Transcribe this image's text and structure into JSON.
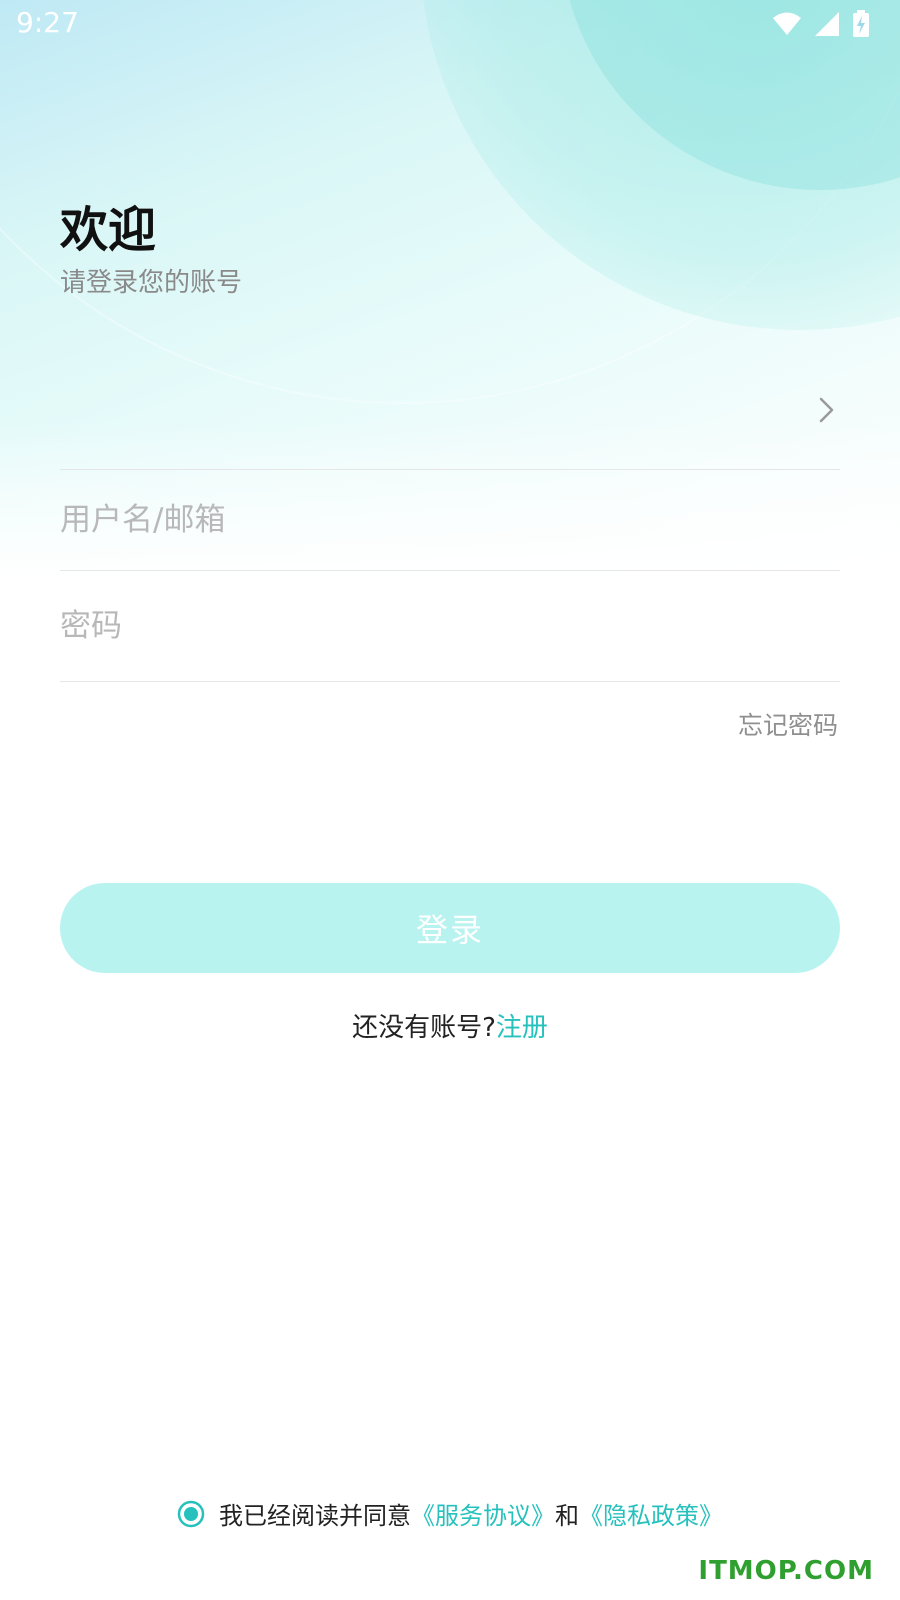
{
  "status_bar": {
    "time": "9:27",
    "icons": [
      "wifi-icon",
      "signal-icon",
      "battery-charging-icon"
    ]
  },
  "header": {
    "title": "欢迎",
    "subtitle": "请登录您的账号"
  },
  "server_selector": {
    "icon": "chevron-right-icon"
  },
  "form": {
    "username_placeholder": "用户名/邮箱",
    "username_value": "",
    "password_placeholder": "密码",
    "password_value": "",
    "forgot_label": "忘记密码",
    "login_label": "登录"
  },
  "register": {
    "prompt": "还没有账号?",
    "link": "注册"
  },
  "agreement": {
    "checked": true,
    "prefix": "我已经阅读并同意",
    "service_link": "《服务协议》",
    "conjunction": "和",
    "privacy_link": "《隐私政策》"
  },
  "watermark": "ITMOP.COM",
  "colors": {
    "accent": "#27c1bd",
    "button_bg": "#b8f3f0",
    "title": "#111111",
    "muted": "#8a8a8a",
    "watermark": "#2fa02f"
  }
}
